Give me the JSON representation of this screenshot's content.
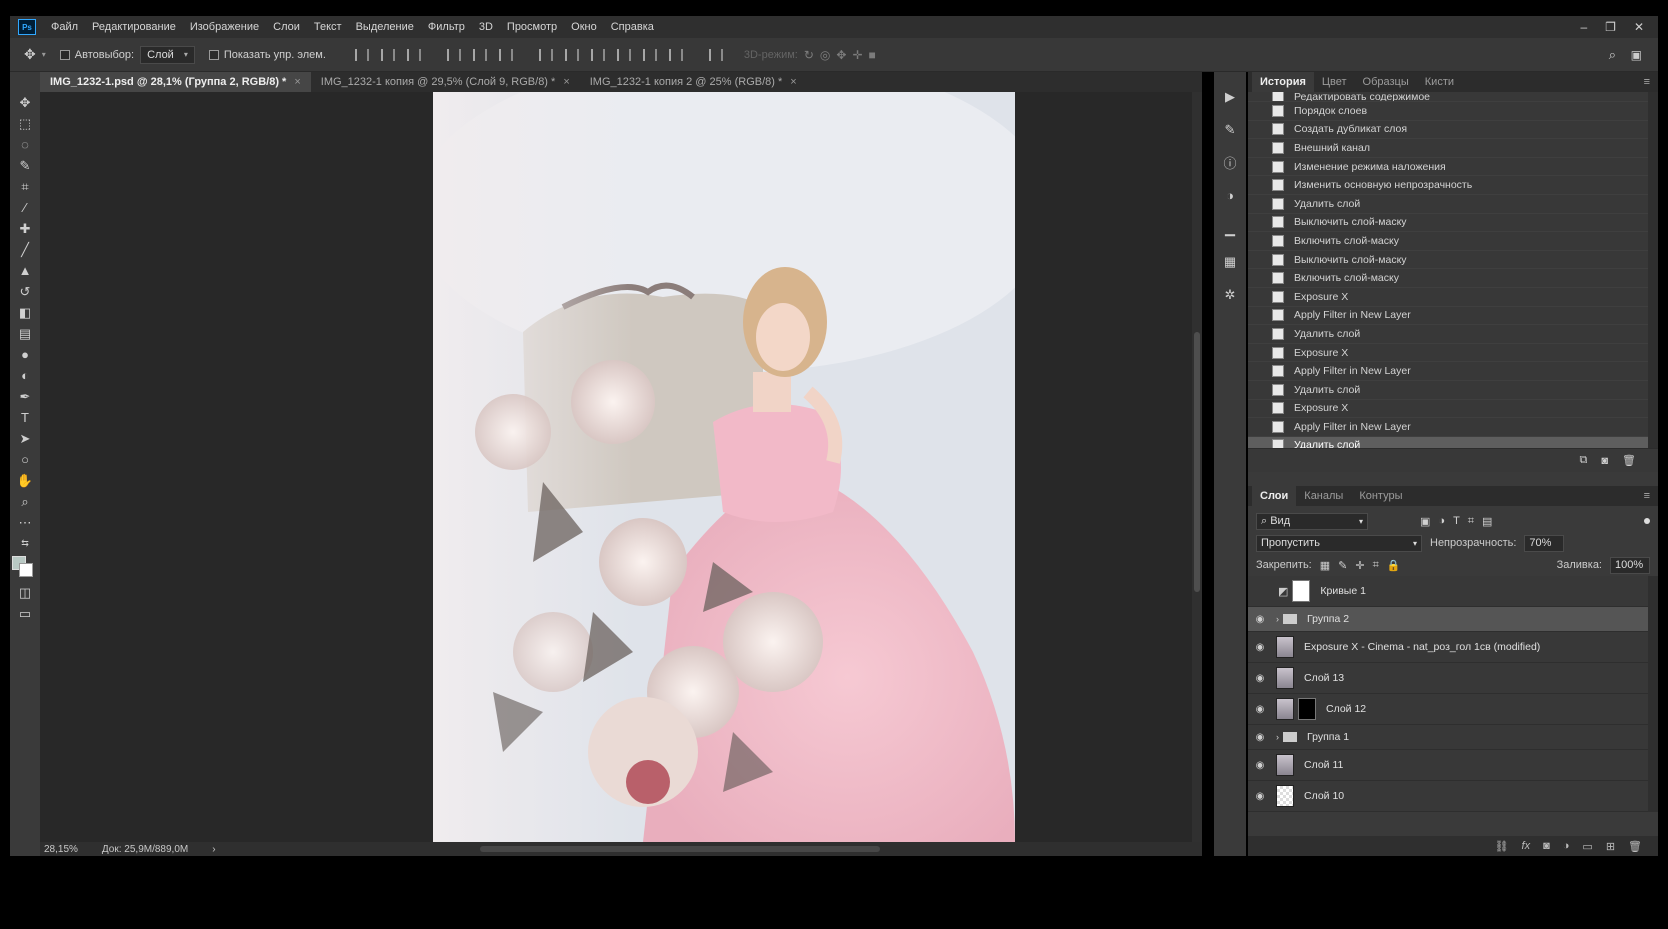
{
  "menu": [
    "Файл",
    "Редактирование",
    "Изображение",
    "Слои",
    "Текст",
    "Выделение",
    "Фильтр",
    "3D",
    "Просмотр",
    "Окно",
    "Справка"
  ],
  "logo": "Ps",
  "window_controls": [
    "–",
    "❐",
    "✕"
  ],
  "options": {
    "autoselect_label": "Автовыбор:",
    "autoselect_value": "Слой",
    "show_transform_label": "Показать упр. элем.",
    "mode3d_label": "3D-режим:"
  },
  "tabs": [
    {
      "label": "IMG_1232-1.psd @ 28,1% (Группа 2, RGB/8) *",
      "active": true
    },
    {
      "label": "IMG_1232-1 копия @ 29,5% (Слой 9, RGB/8) *",
      "active": false
    },
    {
      "label": "IMG_1232-1 копия 2 @ 25% (RGB/8) *",
      "active": false
    }
  ],
  "tab_close": "×",
  "status": {
    "zoom": "28,15%",
    "doc": "Док: 25,9M/889,0M",
    "arrow": "›"
  },
  "history_panel": {
    "tabs": [
      "История",
      "Цвет",
      "Образцы",
      "Кисти"
    ],
    "items": [
      "Редактировать содержимое",
      "Порядок слоев",
      "Создать дубликат слоя",
      "Внешний канал",
      "Изменение режима наложения",
      "Изменить основную непрозрачность",
      "Удалить слой",
      "Выключить слой-маску",
      "Включить слой-маску",
      "Выключить слой-маску",
      "Включить слой-маску",
      "Exposure X",
      "Apply Filter in New Layer",
      "Удалить слой",
      "Exposure X",
      "Apply Filter in New Layer",
      "Удалить слой",
      "Exposure X",
      "Apply Filter in New Layer",
      "Удалить слой"
    ],
    "selected_index": 19
  },
  "layers_panel": {
    "tabs": [
      "Слои",
      "Каналы",
      "Контуры"
    ],
    "filter_placeholder": "Вид",
    "blend_mode": "Пропустить",
    "opacity_label": "Непрозрачность:",
    "opacity_value": "70%",
    "lock_label": "Закрепить:",
    "fill_label": "Заливка:",
    "fill_value": "100%",
    "layers": [
      {
        "name": "Кривые 1",
        "visible": false,
        "type": "adjustment"
      },
      {
        "name": "Группа 2",
        "visible": true,
        "type": "group",
        "selected": true
      },
      {
        "name": "Exposure X - Cinema - nat_роз_гол 1св (modified)",
        "visible": true,
        "type": "pixel"
      },
      {
        "name": "Слой 13",
        "visible": true,
        "type": "pixel"
      },
      {
        "name": "Слой 12",
        "visible": true,
        "type": "masked"
      },
      {
        "name": "Группа 1",
        "visible": true,
        "type": "group"
      },
      {
        "name": "Слой 11",
        "visible": true,
        "type": "pixel"
      },
      {
        "name": "Слой 10",
        "visible": true,
        "type": "pixel"
      }
    ]
  },
  "colors": {
    "accent": "#31a8ff",
    "panel": "#3a3a3a",
    "canvas_bg": "#282828"
  }
}
